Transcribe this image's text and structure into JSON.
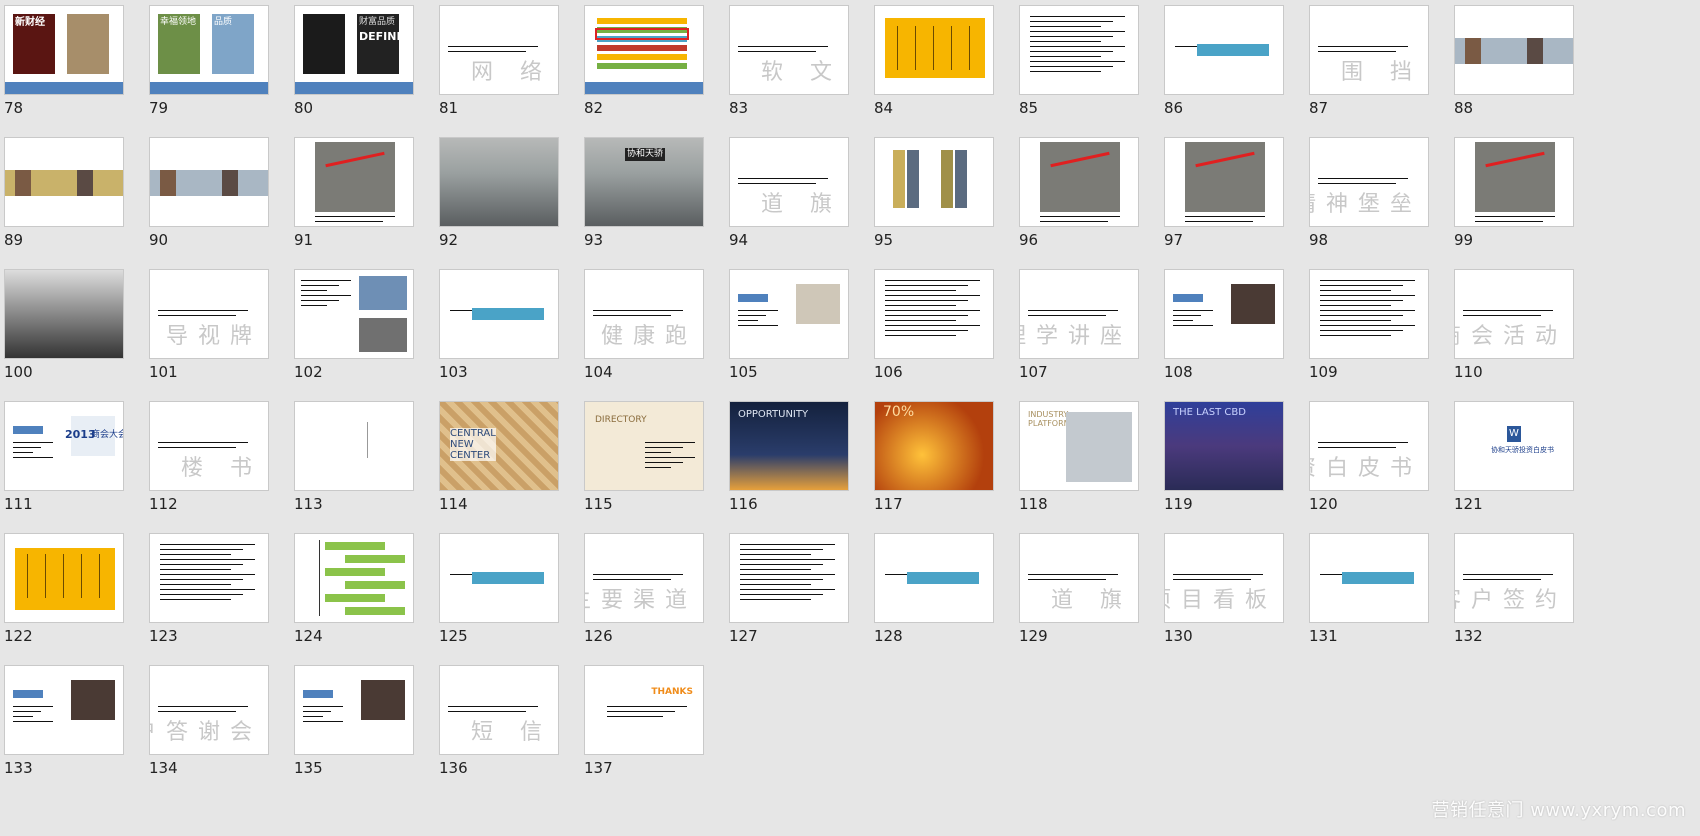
{
  "slides": [
    {
      "n": "78",
      "t": "cover"
    },
    {
      "n": "79",
      "t": "cover"
    },
    {
      "n": "80",
      "t": "cover"
    },
    {
      "n": "81",
      "t": "word",
      "w": "网 络"
    },
    {
      "n": "82",
      "t": "web"
    },
    {
      "n": "83",
      "t": "word",
      "w": "软 文"
    },
    {
      "n": "84",
      "t": "yellow"
    },
    {
      "n": "85",
      "t": "doc"
    },
    {
      "n": "86",
      "t": "banner"
    },
    {
      "n": "87",
      "t": "word",
      "w": "围 挡"
    },
    {
      "n": "88",
      "t": "strip"
    },
    {
      "n": "89",
      "t": "strip"
    },
    {
      "n": "90",
      "t": "strip"
    },
    {
      "n": "91",
      "t": "map"
    },
    {
      "n": "92",
      "t": "photo"
    },
    {
      "n": "93",
      "t": "photo"
    },
    {
      "n": "94",
      "t": "word",
      "w": "道 旗"
    },
    {
      "n": "95",
      "t": "flags"
    },
    {
      "n": "96",
      "t": "map"
    },
    {
      "n": "97",
      "t": "map"
    },
    {
      "n": "98",
      "t": "word",
      "w": "精神堡垒"
    },
    {
      "n": "99",
      "t": "map"
    },
    {
      "n": "100",
      "t": "photo"
    },
    {
      "n": "101",
      "t": "word",
      "w": "导视牌"
    },
    {
      "n": "102",
      "t": "collage"
    },
    {
      "n": "103",
      "t": "banner"
    },
    {
      "n": "104",
      "t": "word",
      "w": "健康跑"
    },
    {
      "n": "105",
      "t": "event"
    },
    {
      "n": "106",
      "t": "doc"
    },
    {
      "n": "107",
      "t": "word",
      "w": "心理学讲座"
    },
    {
      "n": "108",
      "t": "event"
    },
    {
      "n": "109",
      "t": "doc"
    },
    {
      "n": "110",
      "t": "word",
      "w": "商会活动"
    },
    {
      "n": "111",
      "t": "event"
    },
    {
      "n": "112",
      "t": "word",
      "w": "楼 书"
    },
    {
      "n": "113",
      "t": "book"
    },
    {
      "n": "114",
      "t": "cnc"
    },
    {
      "n": "115",
      "t": "dir"
    },
    {
      "n": "116",
      "t": "night"
    },
    {
      "n": "117",
      "t": "orange"
    },
    {
      "n": "118",
      "t": "industry"
    },
    {
      "n": "119",
      "t": "lastcbd"
    },
    {
      "n": "120",
      "t": "word",
      "w": "投资白皮书"
    },
    {
      "n": "121",
      "t": "wordicon"
    },
    {
      "n": "122",
      "t": "yellow2"
    },
    {
      "n": "123",
      "t": "doc2"
    },
    {
      "n": "124",
      "t": "flow"
    },
    {
      "n": "125",
      "t": "banner"
    },
    {
      "n": "126",
      "t": "word",
      "w": "主要渠道"
    },
    {
      "n": "127",
      "t": "doc2"
    },
    {
      "n": "128",
      "t": "banner"
    },
    {
      "n": "129",
      "t": "word",
      "w": "道 旗"
    },
    {
      "n": "130",
      "t": "word",
      "w": "项目看板"
    },
    {
      "n": "131",
      "t": "banner"
    },
    {
      "n": "132",
      "t": "word",
      "w": "大客户签约"
    },
    {
      "n": "133",
      "t": "event"
    },
    {
      "n": "134",
      "t": "word",
      "w": "客户答谢会"
    },
    {
      "n": "135",
      "t": "event"
    },
    {
      "n": "136",
      "t": "word",
      "w": "短 信"
    },
    {
      "n": "137",
      "t": "thanks"
    }
  ],
  "labels": {
    "cover78": "新财经",
    "cover80a": "DEFINE",
    "cover80b": "财富品质",
    "cnc": "CENTRAL\nNEW\nCENTER",
    "dir": "DIRECTORY",
    "night": "OPPORTUNITY",
    "lastcbd": "THE LAST CBD",
    "industry": "INDUSTRY\nPLATFORM",
    "thanks": "THANKS",
    "cover79": "幸福领地",
    "cover79b": "品质",
    "year": "2013",
    "yearlbl": "商会大会",
    "photo93": "协和天骄",
    "percent": "70%",
    "wordicon": "协和天骄投资白皮书"
  },
  "watermark": "营销任意门 www.yxrym.com",
  "colors": {
    "blue": "#4f81bd",
    "teal": "#4aa3c7",
    "yellow": "#f7b500",
    "grey": "#cfcfcf"
  }
}
